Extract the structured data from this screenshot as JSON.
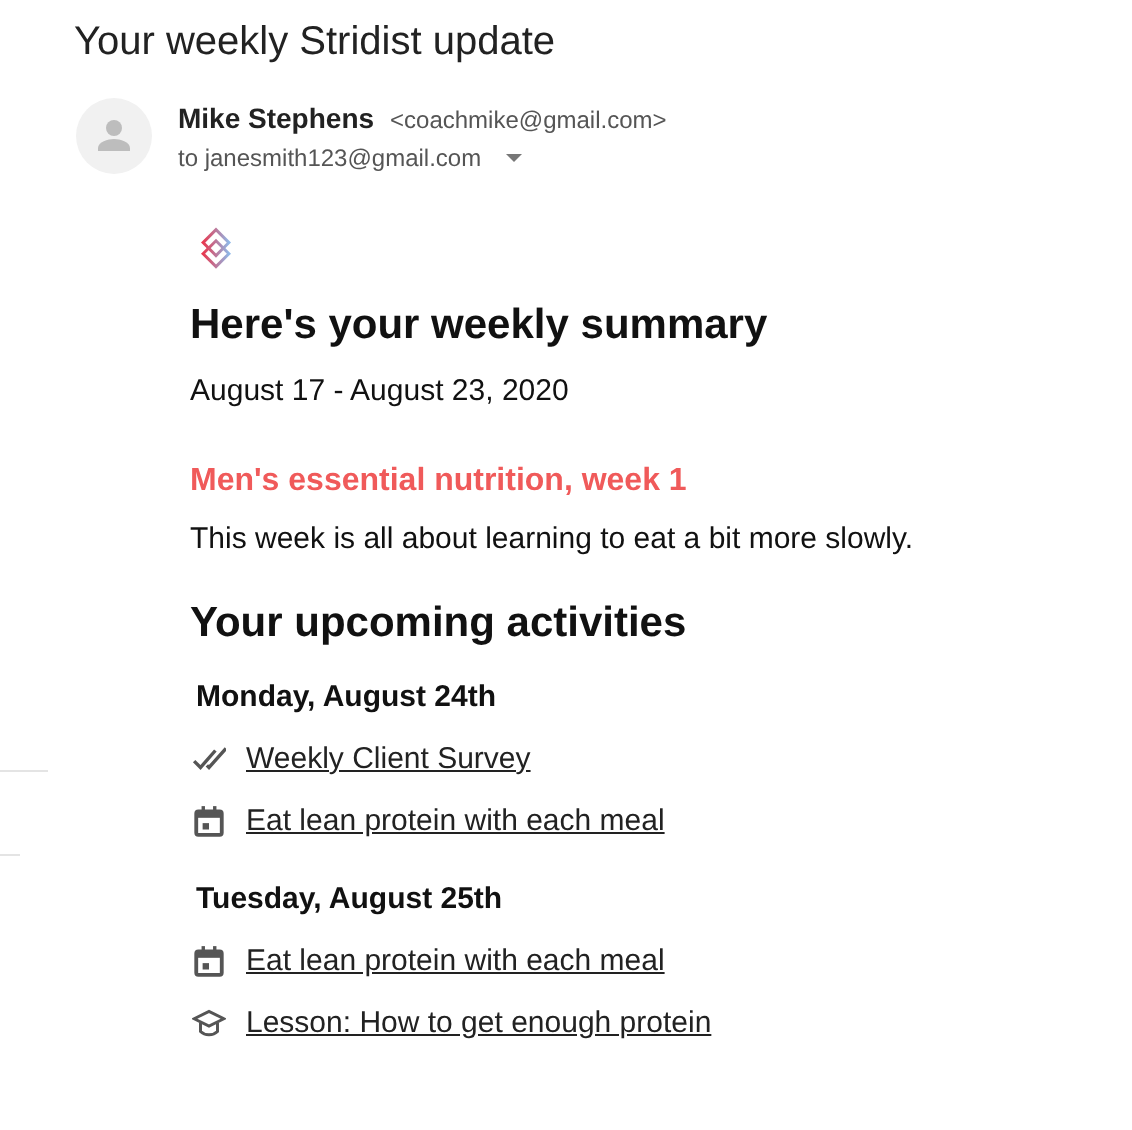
{
  "email": {
    "subject": "Your weekly Stridist update",
    "sender_name": "Mike Stephens",
    "sender_email": "<coachmike@gmail.com>",
    "recipient": "to janesmith123@gmail.com"
  },
  "summary": {
    "heading": "Here's your weekly summary",
    "dates": "August 17 - August 23, 2020",
    "program": "Men's essential nutrition, week 1",
    "description": "This week is all about learning to eat a bit more slowly."
  },
  "activities_heading": "Your upcoming activities",
  "days": [
    {
      "label": "Monday, August 24th",
      "activities": [
        {
          "kind": "survey",
          "title": "Weekly Client Survey"
        },
        {
          "kind": "habit",
          "title": "Eat lean protein with each meal"
        }
      ]
    },
    {
      "label": "Tuesday, August 25th",
      "activities": [
        {
          "kind": "habit",
          "title": "Eat lean protein with each meal"
        },
        {
          "kind": "lesson",
          "title": "Lesson: How to get enough protein"
        }
      ]
    }
  ]
}
